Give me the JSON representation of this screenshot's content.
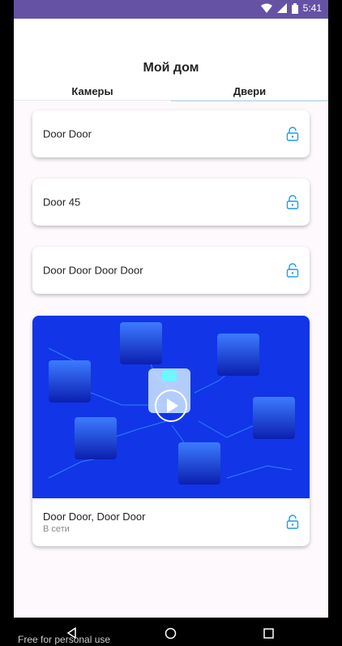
{
  "status_bar": {
    "time": "5:41",
    "bg_color": "#6552a4"
  },
  "header": {
    "title": "Мой дом"
  },
  "tabs": [
    {
      "label": "Камеры",
      "active": false
    },
    {
      "label": "Двери",
      "active": true
    }
  ],
  "doors": [
    {
      "name": "Door Door"
    },
    {
      "name": "Door 45"
    },
    {
      "name": "Door Door Door Door"
    }
  ],
  "video_card": {
    "title": "Door Door, Door Door",
    "status": "В сети"
  },
  "nav": {
    "back_icon": "back-icon",
    "home_icon": "home-icon",
    "recents_icon": "recents-icon"
  },
  "watermark": "Free for personal use",
  "colors": {
    "accent": "#1d9bf0",
    "video_bg": "#1235e8",
    "tab_indicator": "#a8dcef"
  }
}
